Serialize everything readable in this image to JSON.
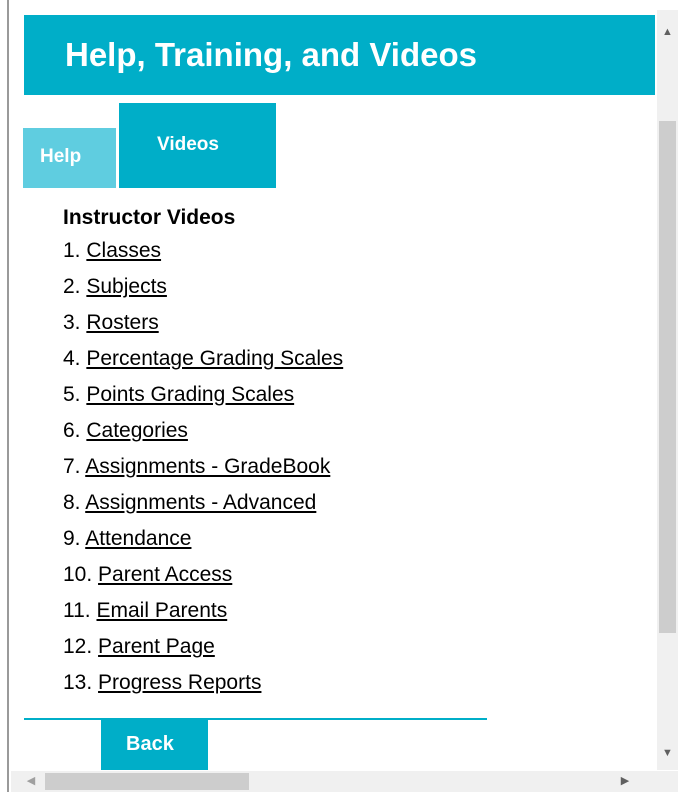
{
  "header": {
    "title": "Help, Training, and Videos"
  },
  "tabs": [
    {
      "label": "Help",
      "active": false
    },
    {
      "label": "Videos",
      "active": true
    }
  ],
  "section": {
    "heading": "Instructor Videos",
    "items": [
      {
        "num": "1.",
        "label": "Classes"
      },
      {
        "num": "2.",
        "label": "Subjects"
      },
      {
        "num": "3.",
        "label": "Rosters"
      },
      {
        "num": "4.",
        "label": "Percentage Grading Scales"
      },
      {
        "num": "5.",
        "label": "Points Grading Scales"
      },
      {
        "num": "6.",
        "label": "Categories"
      },
      {
        "num": "7.",
        "label": "Assignments - GradeBook"
      },
      {
        "num": "8.",
        "label": "Assignments - Advanced"
      },
      {
        "num": "9.",
        "label": "Attendance"
      },
      {
        "num": "10.",
        "label": "Parent Access"
      },
      {
        "num": "11.",
        "label": "Email Parents"
      },
      {
        "num": "12.",
        "label": "Parent Page"
      },
      {
        "num": "13.",
        "label": "Progress Reports"
      }
    ]
  },
  "footer": {
    "back_label": "Back"
  },
  "scrollbars": {
    "up_icon": "▲",
    "down_icon": "▼",
    "left_icon": "◀",
    "right_icon": "▶"
  },
  "colors": {
    "accent": "#00aec8",
    "tab_inactive": "#5fcde0",
    "text": "#000000"
  }
}
